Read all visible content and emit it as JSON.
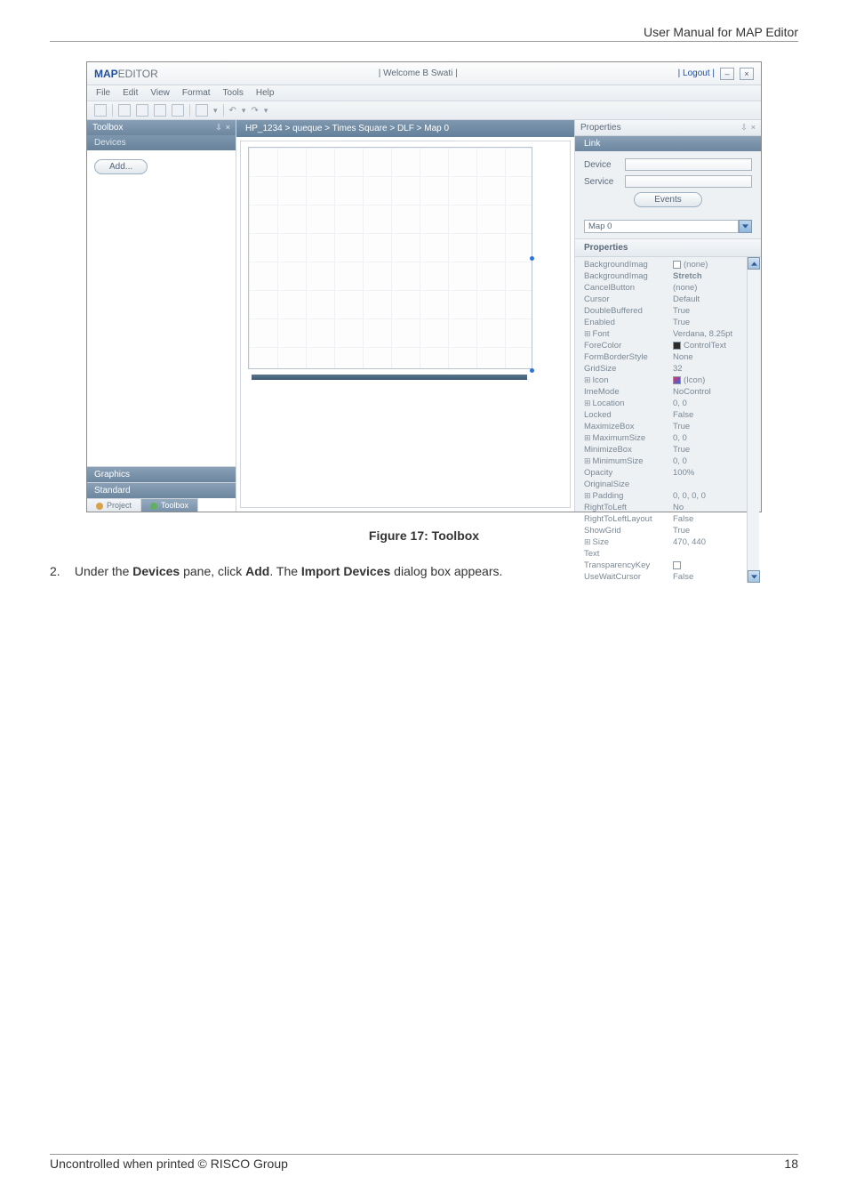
{
  "doc": {
    "header_right": "User Manual for MAP Editor",
    "figure_caption": "Figure 17: Toolbox",
    "step_number": "2.",
    "step_part1": "Under the ",
    "step_bold1": "Devices",
    "step_part2": " pane, click ",
    "step_bold2": "Add",
    "step_part3": ". The ",
    "step_bold3": "Import Devices",
    "step_part4": " dialog box appears.",
    "footer_left": "Uncontrolled when printed © RISCO Group",
    "footer_right": "18"
  },
  "app": {
    "title_bold": "MAP",
    "title_rest": "EDITOR",
    "welcome": "|  Welcome  B Swati  |",
    "logout": "| Logout |",
    "menu": [
      "File",
      "Edit",
      "View",
      "Format",
      "Tools",
      "Help"
    ],
    "breadcrumb": "HP_1234 > queque > Times Square > DLF > Map 0",
    "left": {
      "toolbox": "Toolbox",
      "devices": "Devices",
      "add": "Add...",
      "graphics": "Graphics",
      "standard": "Standard",
      "tab_project": "Project",
      "tab_toolbox": "Toolbox"
    },
    "right": {
      "properties_title": "Properties",
      "link": "Link",
      "device": "Device",
      "service": "Service",
      "events": "Events",
      "combo_value": "Map 0",
      "properties_header": "Properties",
      "props": [
        {
          "k": "BackgroundImag",
          "v": "(none)",
          "swatch": "#ffffff"
        },
        {
          "k": "BackgroundImag",
          "v": "Stretch",
          "bold": true
        },
        {
          "k": "CancelButton",
          "v": "(none)"
        },
        {
          "k": "Cursor",
          "v": "Default"
        },
        {
          "k": "DoubleBuffered",
          "v": "True"
        },
        {
          "k": "Enabled",
          "v": "True"
        },
        {
          "k": "Font",
          "v": "Verdana, 8.25pt",
          "expand": true
        },
        {
          "k": "ForeColor",
          "v": "ControlText",
          "swatch": "#2b2b2b"
        },
        {
          "k": "FormBorderStyle",
          "v": "None"
        },
        {
          "k": "GridSize",
          "v": "32"
        },
        {
          "k": "Icon",
          "v": "(Icon)",
          "expand": true,
          "icon": true
        },
        {
          "k": "ImeMode",
          "v": "NoControl"
        },
        {
          "k": "Location",
          "v": "0, 0",
          "expand": true
        },
        {
          "k": "Locked",
          "v": "False"
        },
        {
          "k": "MaximizeBox",
          "v": "True"
        },
        {
          "k": "MaximumSize",
          "v": "0, 0",
          "expand": true
        },
        {
          "k": "MinimizeBox",
          "v": "True"
        },
        {
          "k": "MinimumSize",
          "v": "0, 0",
          "expand": true
        },
        {
          "k": "Opacity",
          "v": "100%"
        },
        {
          "k": "OriginalSize",
          "v": ""
        },
        {
          "k": "Padding",
          "v": "0, 0, 0, 0",
          "expand": true
        },
        {
          "k": "RightToLeft",
          "v": "No"
        },
        {
          "k": "RightToLeftLayout",
          "v": "False"
        },
        {
          "k": "ShowGrid",
          "v": "True"
        },
        {
          "k": "Size",
          "v": "470, 440",
          "expand": true
        },
        {
          "k": "Text",
          "v": ""
        },
        {
          "k": "TransparencyKey",
          "v": "",
          "swatch": "#ffffff"
        },
        {
          "k": "UseWaitCursor",
          "v": "False"
        }
      ]
    }
  }
}
